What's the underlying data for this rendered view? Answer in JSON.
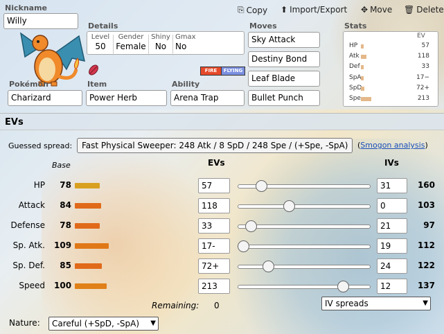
{
  "nickname": {
    "label": "Nickname",
    "value": "Willy"
  },
  "toolbar": {
    "copy": "Copy",
    "import_export": "Import/Export",
    "move": "Move",
    "delete": "Delete"
  },
  "details": {
    "label": "Details",
    "level": {
      "h": "Level",
      "v": "50"
    },
    "gender": {
      "h": "Gender",
      "v": "Female"
    },
    "shiny": {
      "h": "Shiny",
      "v": "No"
    },
    "gmax": {
      "h": "Gmax",
      "v": "No"
    }
  },
  "types": [
    {
      "name": "FIRE",
      "color": "#e64a2a"
    },
    {
      "name": "FLYING",
      "color": "#7a8fe0"
    }
  ],
  "pokemon": {
    "label": "Pokémon",
    "value": "Charizard"
  },
  "item": {
    "label": "Item",
    "value": "Power Herb"
  },
  "ability": {
    "label": "Ability",
    "value": "Arena Trap"
  },
  "moves": {
    "label": "Moves",
    "list": [
      "Sky Attack",
      "Destiny Bond",
      "Leaf Blade",
      "Bullet Punch"
    ]
  },
  "stats": {
    "label": "Stats",
    "ev_header": "EV",
    "rows": [
      {
        "n": "HP",
        "ev": "57",
        "fill": 0.22
      },
      {
        "n": "Atk",
        "ev": "118",
        "fill": 0.46
      },
      {
        "n": "Def",
        "ev": "33",
        "fill": 0.13
      },
      {
        "n": "SpA",
        "ev": "17−",
        "fill": 0.07
      },
      {
        "n": "SpD",
        "ev": "72+",
        "fill": 0.28
      },
      {
        "n": "Spe",
        "ev": "213",
        "fill": 0.84
      }
    ]
  },
  "evs_section": {
    "title": "EVs",
    "guessed_label": "Guessed spread:",
    "guessed_value": "Fast Physical Sweeper: 248 Atk / 8 SpD / 248 Spe / (+Spe, -SpA)",
    "smogon_open": "(",
    "smogon_link": "Smogon analysis",
    "smogon_close": ")",
    "col_base": "Base",
    "col_evs": "EVs",
    "col_ivs": "IVs",
    "remaining_label": "Remaining:",
    "remaining_value": "0",
    "iv_spreads": "IV spreads",
    "nature_label": "Nature:",
    "nature_value": "Careful (+SpD, -SpA)"
  },
  "stat_rows": [
    {
      "name": "HP",
      "base": "78",
      "ev": "57",
      "iv": "31",
      "total": "160",
      "ev_frac": 0.18,
      "base_frac": 0.31,
      "bar_color": "#d9a020"
    },
    {
      "name": "Attack",
      "base": "84",
      "ev": "118",
      "iv": "0",
      "total": "103",
      "ev_frac": 0.39,
      "base_frac": 0.33,
      "bar_color": "#e06a1a"
    },
    {
      "name": "Defense",
      "base": "78",
      "ev": "33",
      "iv": "21",
      "total": "97",
      "ev_frac": 0.1,
      "base_frac": 0.31,
      "bar_color": "#e06a1a"
    },
    {
      "name": "Sp. Atk.",
      "base": "109",
      "ev": "17-",
      "iv": "19",
      "total": "112",
      "ev_frac": 0.04,
      "base_frac": 0.43,
      "bar_color": "#e07818"
    },
    {
      "name": "Sp. Def.",
      "base": "85",
      "ev": "72+",
      "iv": "24",
      "total": "122",
      "ev_frac": 0.23,
      "base_frac": 0.34,
      "bar_color": "#e06a1a"
    },
    {
      "name": "Speed",
      "base": "100",
      "ev": "213",
      "iv": "12",
      "total": "137",
      "ev_frac": 0.8,
      "base_frac": 0.4,
      "bar_color": "#e08018"
    }
  ]
}
